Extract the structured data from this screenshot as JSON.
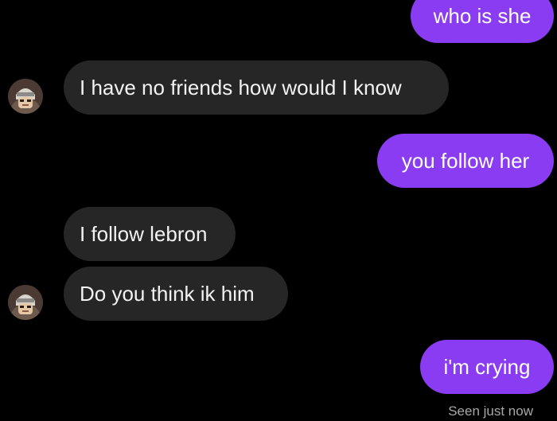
{
  "conversation": {
    "messages": [
      {
        "sender": "me",
        "text": "who is she"
      },
      {
        "sender": "them",
        "text": "I have no friends how would I know"
      },
      {
        "sender": "me",
        "text": "you follow her"
      },
      {
        "sender": "them",
        "text": "I follow lebron"
      },
      {
        "sender": "them",
        "text": "Do you think ik him"
      },
      {
        "sender": "me",
        "text": "i'm crying"
      }
    ],
    "seen_status": "Seen just now"
  },
  "colors": {
    "background": "#000000",
    "sent_bubble": "#8a3cf2",
    "received_bubble": "#262626"
  },
  "icons": {
    "contact_avatar": "profile-avatar-icon"
  }
}
